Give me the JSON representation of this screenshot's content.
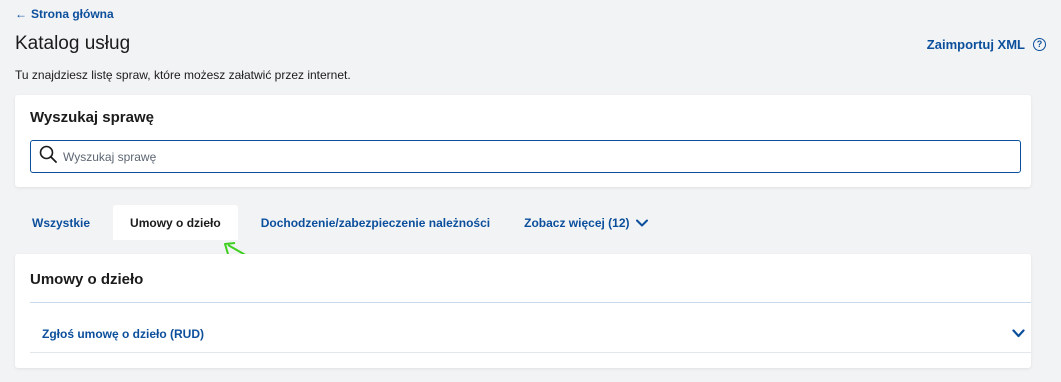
{
  "nav": {
    "back_label": "Strona główna"
  },
  "header": {
    "title": "Katalog usług",
    "import_label": "Zaimportuj XML",
    "subtitle": "Tu znajdziesz listę spraw, które możesz załatwić przez internet."
  },
  "search": {
    "heading": "Wyszukaj sprawę",
    "placeholder": "Wyszukaj sprawę",
    "value": ""
  },
  "tabs": [
    {
      "label": "Wszystkie",
      "active": false
    },
    {
      "label": "Umowy o dzieło",
      "active": true
    },
    {
      "label": "Dochodzenie/zabezpieczenie należności",
      "active": false
    },
    {
      "label": "Zobacz więcej (12)",
      "active": false
    }
  ],
  "section": {
    "heading": "Umowy o dzieło",
    "items": [
      {
        "label": "Zgłoś umowę o dzieło (RUD)"
      }
    ]
  },
  "colors": {
    "accent": "#0b4f9c",
    "background": "#f2f3f5",
    "annotation_arrow": "#3ecf1f"
  }
}
